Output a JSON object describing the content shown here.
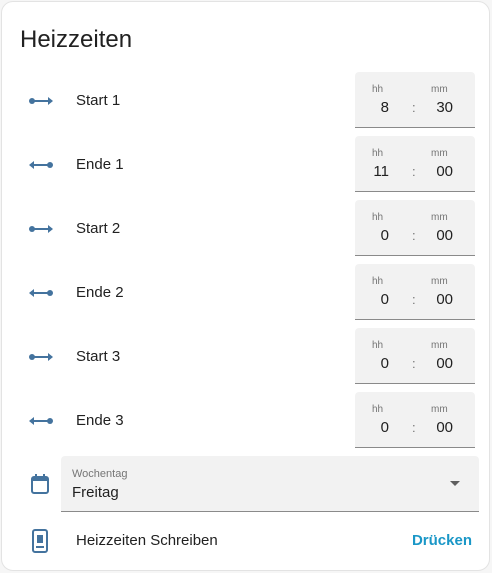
{
  "title": "Heizzeiten",
  "time_caption_hours": "hh",
  "time_caption_minutes": "mm",
  "time_separator": ":",
  "rows": [
    {
      "label": "Start 1",
      "icon": "arrow-start-icon",
      "hours": "8",
      "minutes": "30"
    },
    {
      "label": "Ende 1",
      "icon": "arrow-end-icon",
      "hours": "11",
      "minutes": "00"
    },
    {
      "label": "Start 2",
      "icon": "arrow-start-icon",
      "hours": "0",
      "minutes": "00"
    },
    {
      "label": "Ende 2",
      "icon": "arrow-end-icon",
      "hours": "0",
      "minutes": "00"
    },
    {
      "label": "Start 3",
      "icon": "arrow-start-icon",
      "hours": "0",
      "minutes": "00"
    },
    {
      "label": "Ende 3",
      "icon": "arrow-end-icon",
      "hours": "0",
      "minutes": "00"
    }
  ],
  "weekday": {
    "caption": "Wochentag",
    "value": "Freitag",
    "icon": "calendar-icon"
  },
  "write": {
    "label": "Heizzeiten Schreiben",
    "button": "Drücken",
    "icon": "remote-icon"
  },
  "colors": {
    "icon": "#44739e",
    "accent": "#1a97c7"
  }
}
